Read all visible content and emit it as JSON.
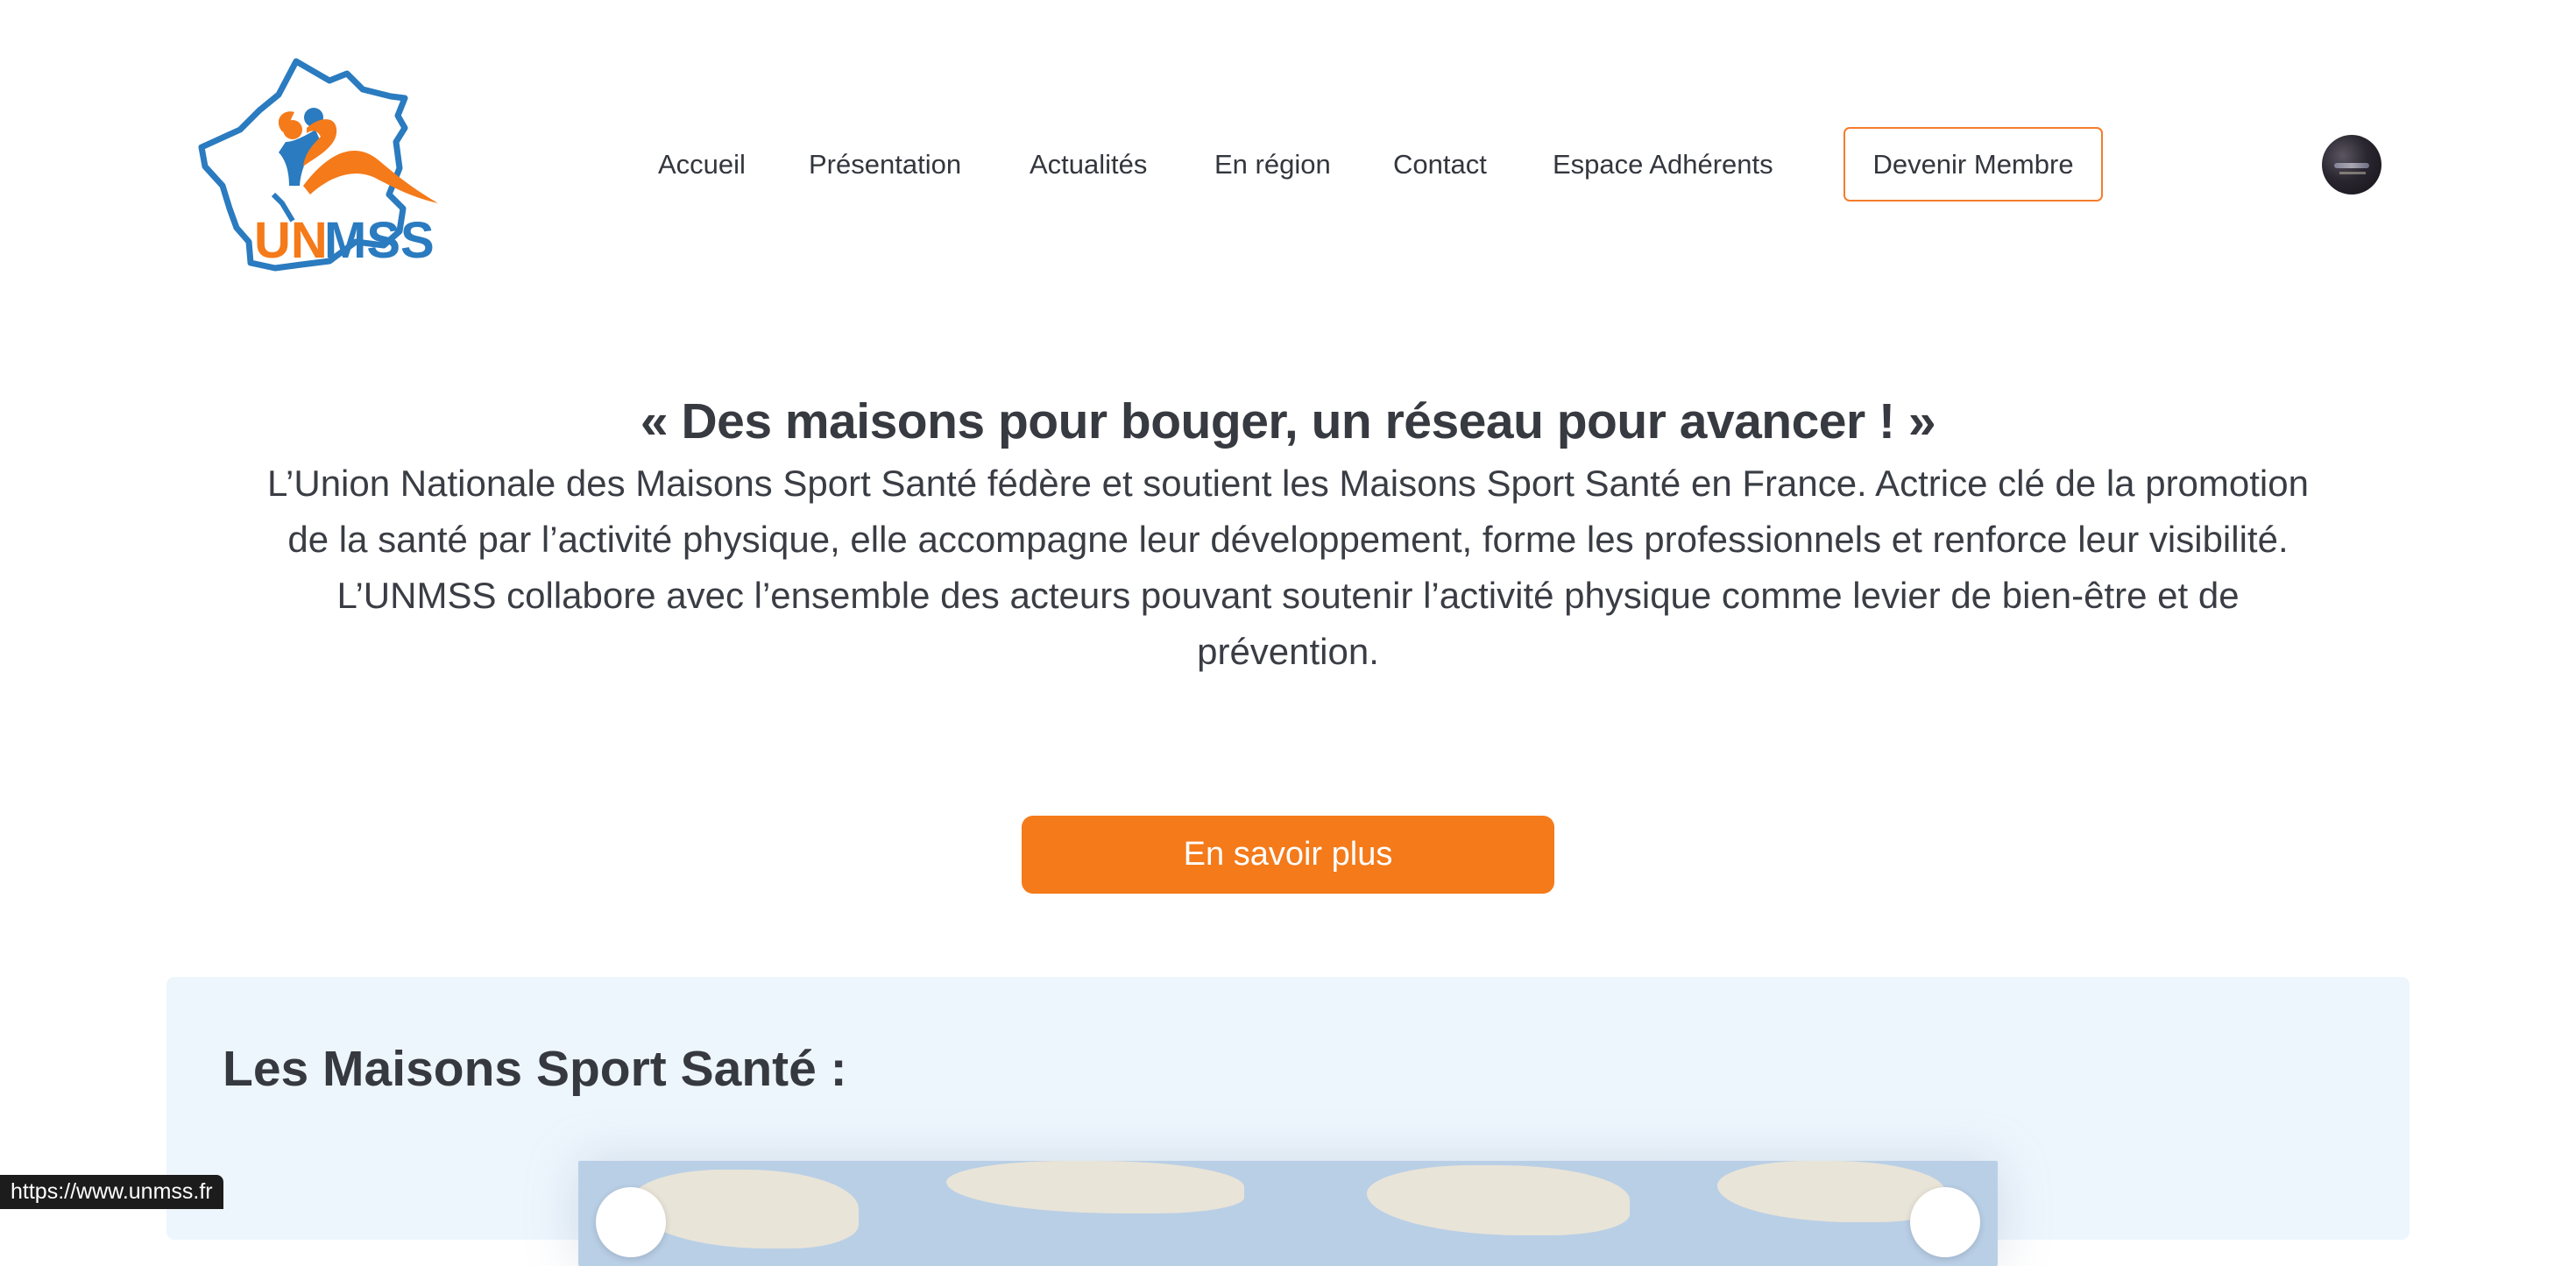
{
  "logo": {
    "text_un": "UN",
    "text_mss": "MSS",
    "alt": "UNMSS"
  },
  "nav": {
    "items": [
      {
        "label": "Accueil"
      },
      {
        "label": "Présentation"
      },
      {
        "label": "Actualités"
      },
      {
        "label": "En région"
      },
      {
        "label": "Contact"
      },
      {
        "label": "Espace Adhérents"
      }
    ],
    "cta_label": "Devenir Membre"
  },
  "hero": {
    "title": "« Des maisons pour bouger, un réseau pour avancer ! »",
    "text": "L’Union Nationale des Maisons Sport Santé fédère et soutient les Maisons Sport Santé en France. Actrice clé de la promotion de la santé par l’activité physique, elle accompagne leur développement, forme les professionnels et renforce leur visibilité. L’UNMSS collabore avec l’ensemble des acteurs pouvant soutenir l’activité physique comme levier de bien-être et de prévention.",
    "button_label": "En savoir plus"
  },
  "section": {
    "title": "Les Maisons Sport Santé :"
  },
  "status_bar": {
    "url": "https://www.unmss.fr"
  },
  "colors": {
    "accent_orange": "#f47a1a",
    "brand_blue": "#2a7bbf",
    "section_bg": "#eef6fd",
    "text": "#3a3d44"
  }
}
